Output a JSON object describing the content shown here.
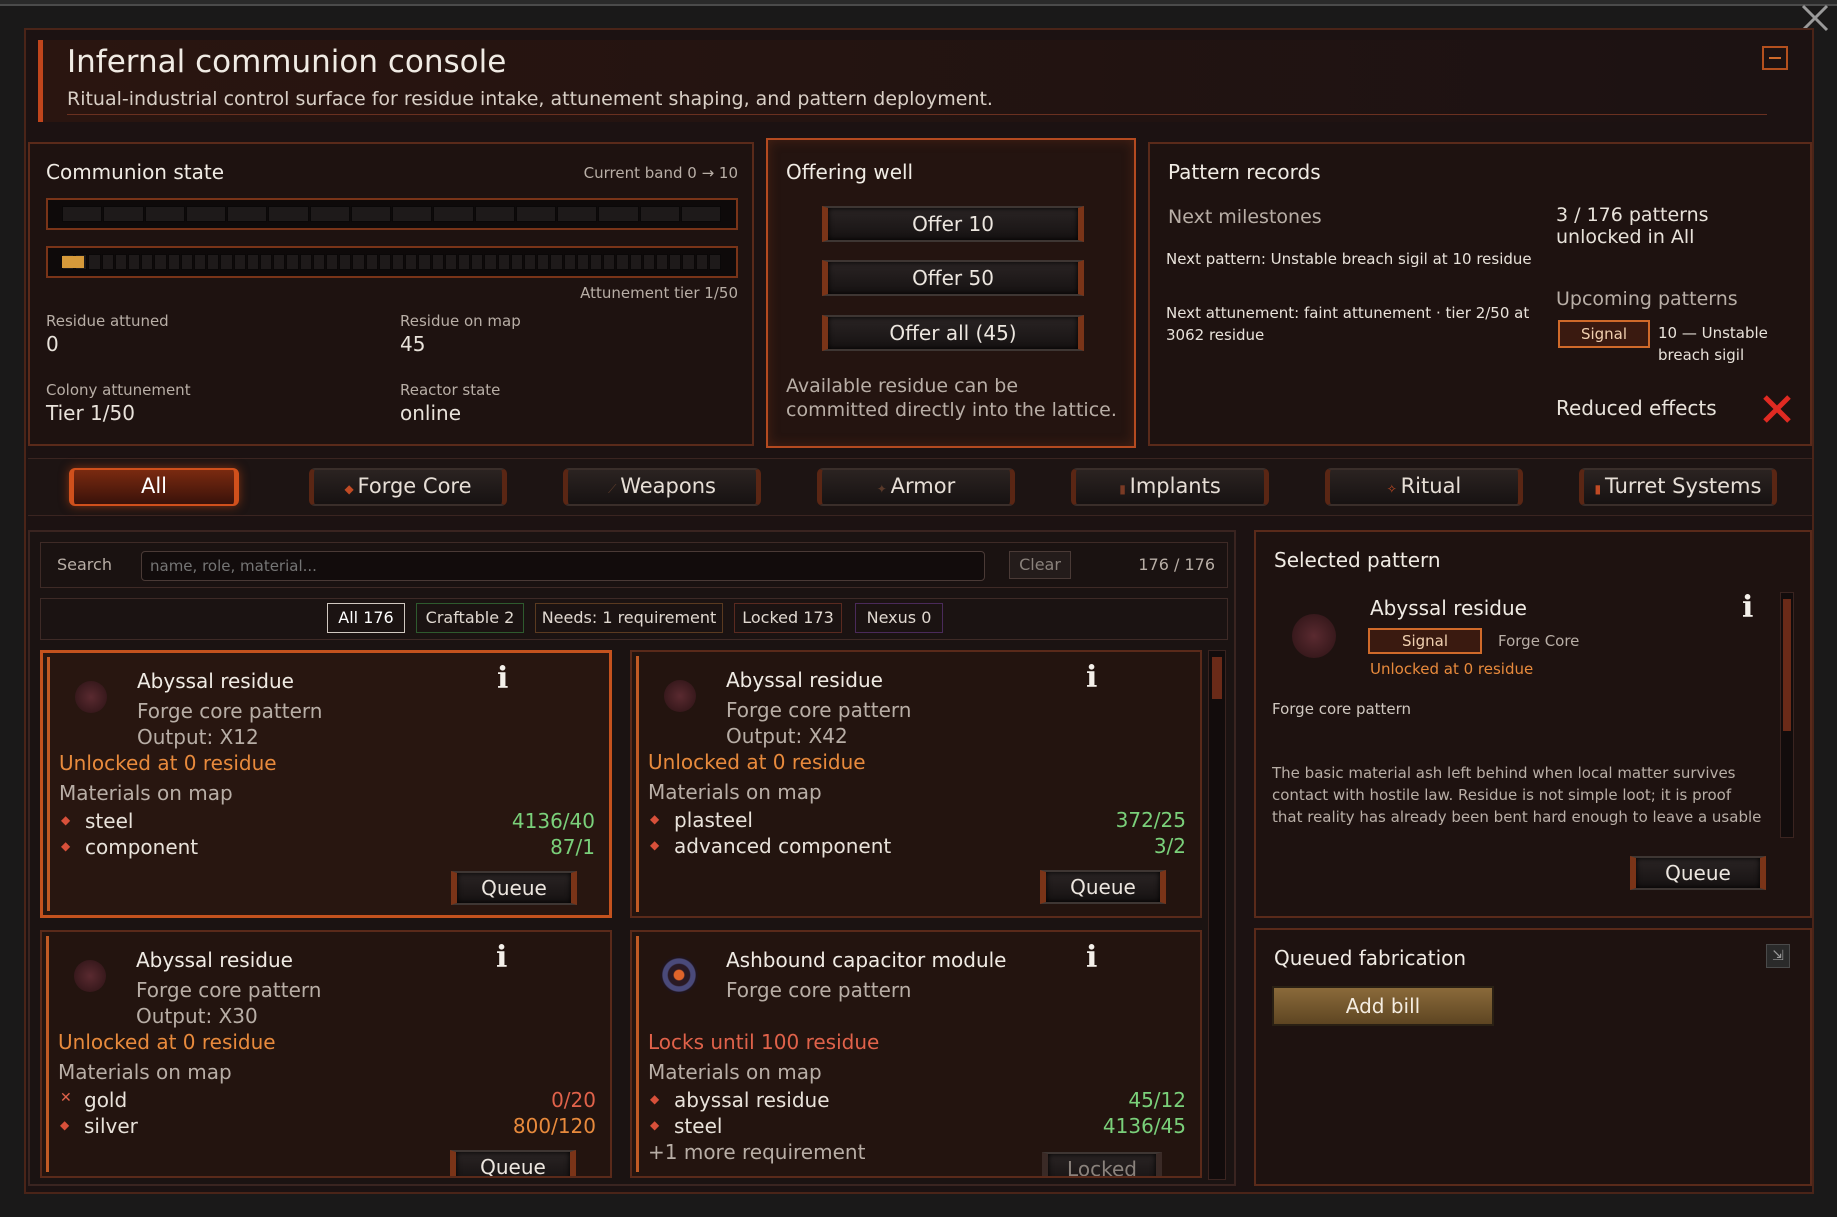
{
  "header": {
    "title": "Infernal communion console",
    "subtitle": "Ritual-industrial control surface for residue intake, attunement shaping, and pattern deployment."
  },
  "communion": {
    "heading": "Communion state",
    "band": "Current band 0 → 10",
    "band_progress": 0,
    "attunement_progress": 0.02,
    "attunement_tier": "Attunement tier 1/50",
    "stats": [
      {
        "label": "Residue attuned",
        "value": "0"
      },
      {
        "label": "Residue on map",
        "value": "45"
      },
      {
        "label": "Colony attunement",
        "value": "Tier 1/50"
      },
      {
        "label": "Reactor state",
        "value": "online"
      }
    ]
  },
  "offering": {
    "heading": "Offering well",
    "buttons": [
      "Offer 10",
      "Offer 50",
      "Offer all (45)"
    ],
    "note": "Available residue can be committed directly into the lattice."
  },
  "records": {
    "heading": "Pattern records",
    "milestones_heading": "Next milestones",
    "next_pattern": "Next pattern: Unstable breach sigil at 10 residue",
    "next_attunement": "Next attunement: faint attunement · tier 2/50 at 3062 residue",
    "unlocked": "3 / 176 patterns unlocked in All",
    "upcoming_heading": "Upcoming patterns",
    "upcoming_tag": "Signal",
    "upcoming_text": "10 — Unstable breach sigil",
    "reduced_effects": "Reduced effects"
  },
  "tabs": [
    "All",
    "Forge Core",
    "Weapons",
    "Armor",
    "Implants",
    "Ritual",
    "Turret Systems"
  ],
  "search": {
    "label": "Search",
    "placeholder": "name, role, material...",
    "clear": "Clear",
    "count": "176 / 176"
  },
  "filters": [
    "All 176",
    "Craftable 2",
    "Needs: 1 requirement",
    "Locked 173",
    "Nexus 0"
  ],
  "cards": [
    {
      "name": "Abyssal residue",
      "type": "Forge core pattern",
      "output": "Output: X12",
      "status": "Unlocked at 0 residue",
      "materials_heading": "Materials on map",
      "materials": [
        {
          "name": "steel",
          "qty": "4136/40",
          "ok": true
        },
        {
          "name": "component",
          "qty": "87/1",
          "ok": true
        }
      ],
      "more": "",
      "action": "Queue"
    },
    {
      "name": "Abyssal residue",
      "type": "Forge core pattern",
      "output": "Output: X42",
      "status": "Unlocked at 0 residue",
      "materials_heading": "Materials on map",
      "materials": [
        {
          "name": "plasteel",
          "qty": "372/25",
          "ok": true
        },
        {
          "name": "advanced component",
          "qty": "3/2",
          "ok": true
        }
      ],
      "more": "",
      "action": "Queue"
    },
    {
      "name": "Abyssal residue",
      "type": "Forge core pattern",
      "output": "Output: X30",
      "status": "Unlocked at 0 residue",
      "materials_heading": "Materials on map",
      "materials": [
        {
          "name": "gold",
          "qty": "0/20",
          "ok": false
        },
        {
          "name": "silver",
          "qty": "800/120",
          "ok": true
        }
      ],
      "more": "",
      "action": "Queue"
    },
    {
      "name": "Ashbound capacitor module",
      "type": "Forge core pattern",
      "output": "",
      "status": "Locks until 100 residue",
      "materials_heading": "Materials on map",
      "materials": [
        {
          "name": "abyssal residue",
          "qty": "45/12",
          "ok": true
        },
        {
          "name": "steel",
          "qty": "4136/45",
          "ok": true
        }
      ],
      "more": "+1 more requirement",
      "action": "Locked"
    }
  ],
  "selected": {
    "heading": "Selected pattern",
    "name": "Abyssal residue",
    "tag": "Signal",
    "category": "Forge Core",
    "status": "Unlocked at 0 residue",
    "type": "Forge core pattern",
    "description": "The basic material ash left behind when local matter survives contact with hostile law. Residue is not simple loot; it is proof that reality has already been bent hard enough to leave a usable scar.",
    "action": "Queue"
  },
  "queue": {
    "heading": "Queued fabrication",
    "add_bill": "Add bill"
  },
  "colors": {
    "accent": "#c4521e",
    "ok": "#7ad07a",
    "bad": "#e0624a",
    "warn": "#e88a3c"
  }
}
